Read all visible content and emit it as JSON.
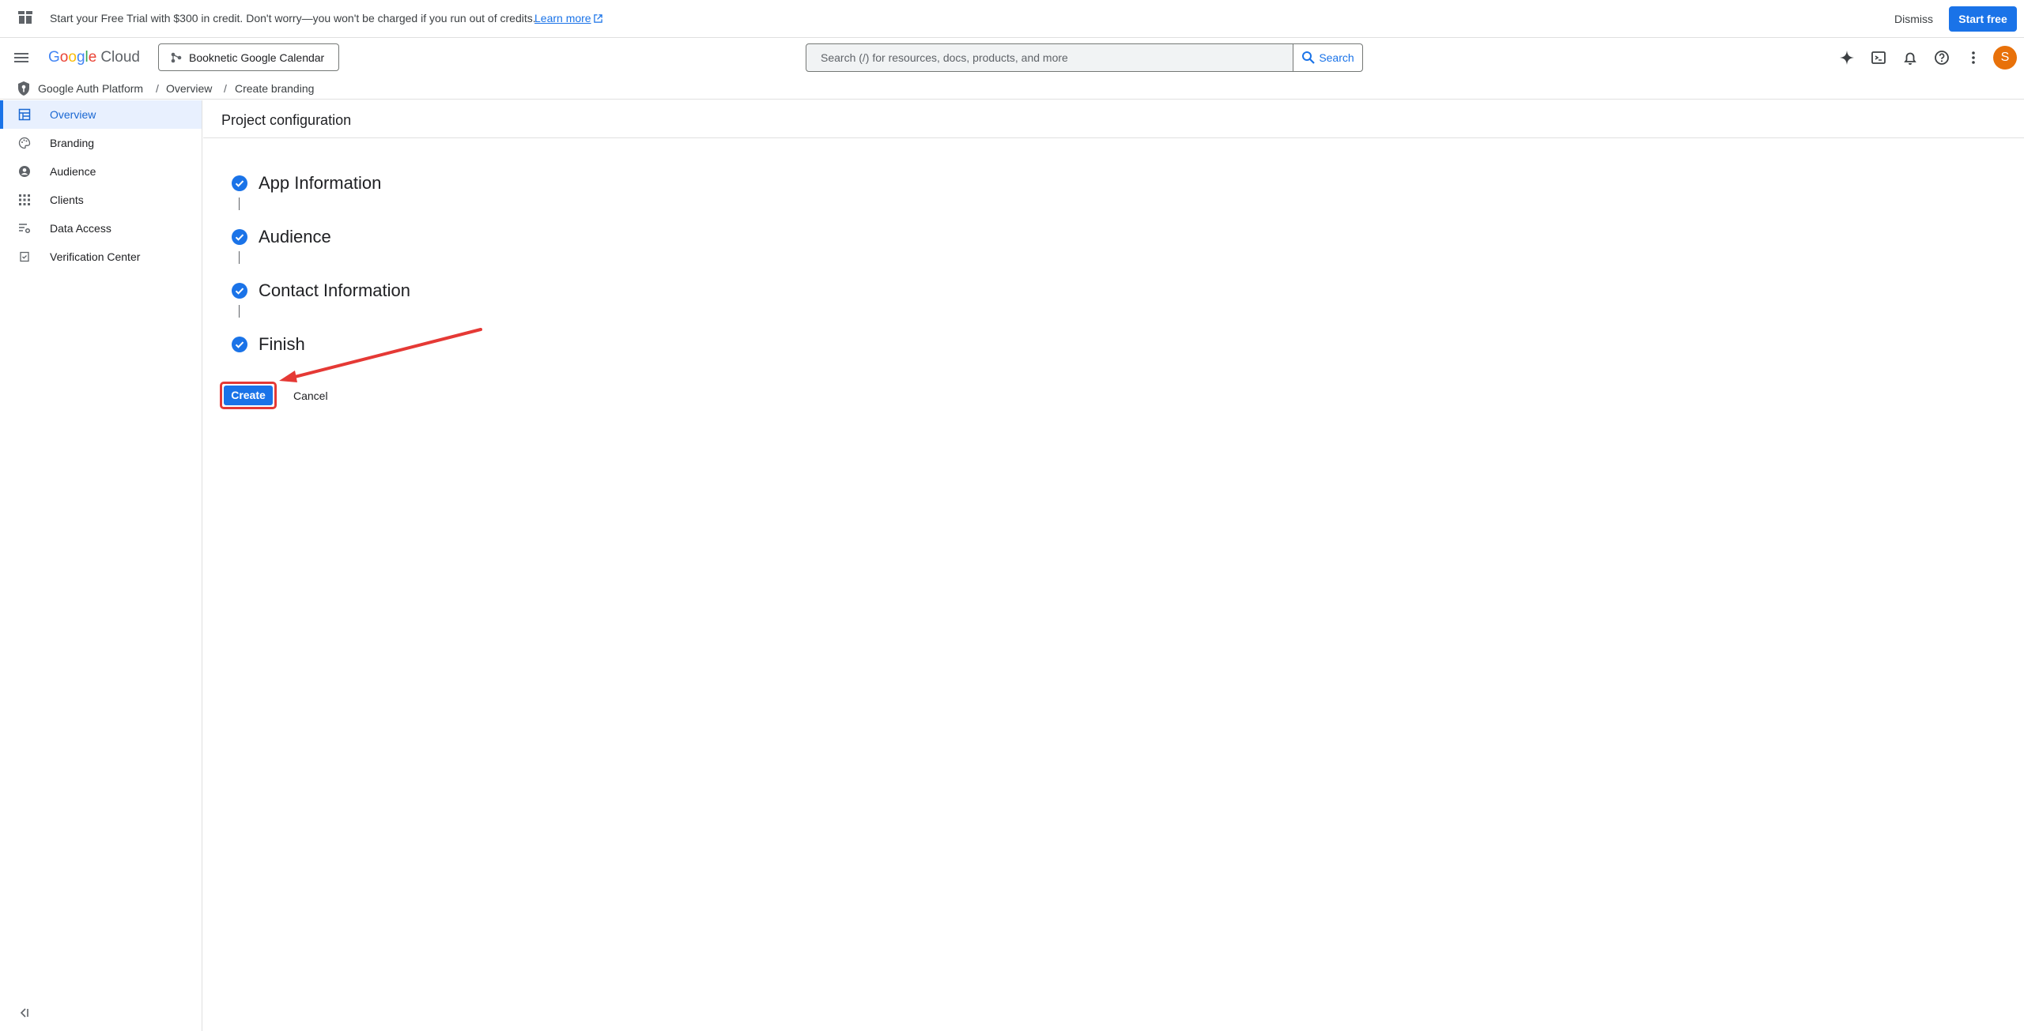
{
  "banner": {
    "message": "Start your Free Trial with $300 in credit. Don't worry—you won't be charged if you run out of credits.",
    "learn_more": "Learn more",
    "dismiss": "Dismiss",
    "start_free": "Start free"
  },
  "header": {
    "logo_google": [
      "G",
      "o",
      "o",
      "g",
      "l",
      "e"
    ],
    "logo_cloud": "Cloud",
    "project_name": "Booknetic Google Calendar",
    "search_placeholder": "Search (/) for resources, docs, products, and more",
    "search_button": "Search",
    "avatar_initial": "S",
    "icons": [
      "gemini-icon",
      "cloud-shell-icon",
      "notifications-icon",
      "help-icon",
      "more-vert-icon"
    ]
  },
  "breadcrumb": [
    "Google Auth Platform",
    "Overview",
    "Create branding"
  ],
  "sidebar": {
    "items": [
      {
        "label": "Overview",
        "icon": "dashboard-icon",
        "active": true
      },
      {
        "label": "Branding",
        "icon": "palette-icon",
        "active": false
      },
      {
        "label": "Audience",
        "icon": "account-circle-icon",
        "active": false
      },
      {
        "label": "Clients",
        "icon": "apps-grid-icon",
        "active": false
      },
      {
        "label": "Data Access",
        "icon": "data-settings-icon",
        "active": false
      },
      {
        "label": "Verification Center",
        "icon": "verification-icon",
        "active": false
      }
    ]
  },
  "main": {
    "title": "Project configuration",
    "steps": [
      {
        "label": "App Information",
        "done": true
      },
      {
        "label": "Audience",
        "done": true
      },
      {
        "label": "Contact Information",
        "done": true
      },
      {
        "label": "Finish",
        "done": true
      }
    ],
    "create_button": "Create",
    "cancel_button": "Cancel"
  },
  "colors": {
    "accent": "#1a73e8",
    "annotation": "#e53935",
    "avatar": "#e8710a"
  }
}
